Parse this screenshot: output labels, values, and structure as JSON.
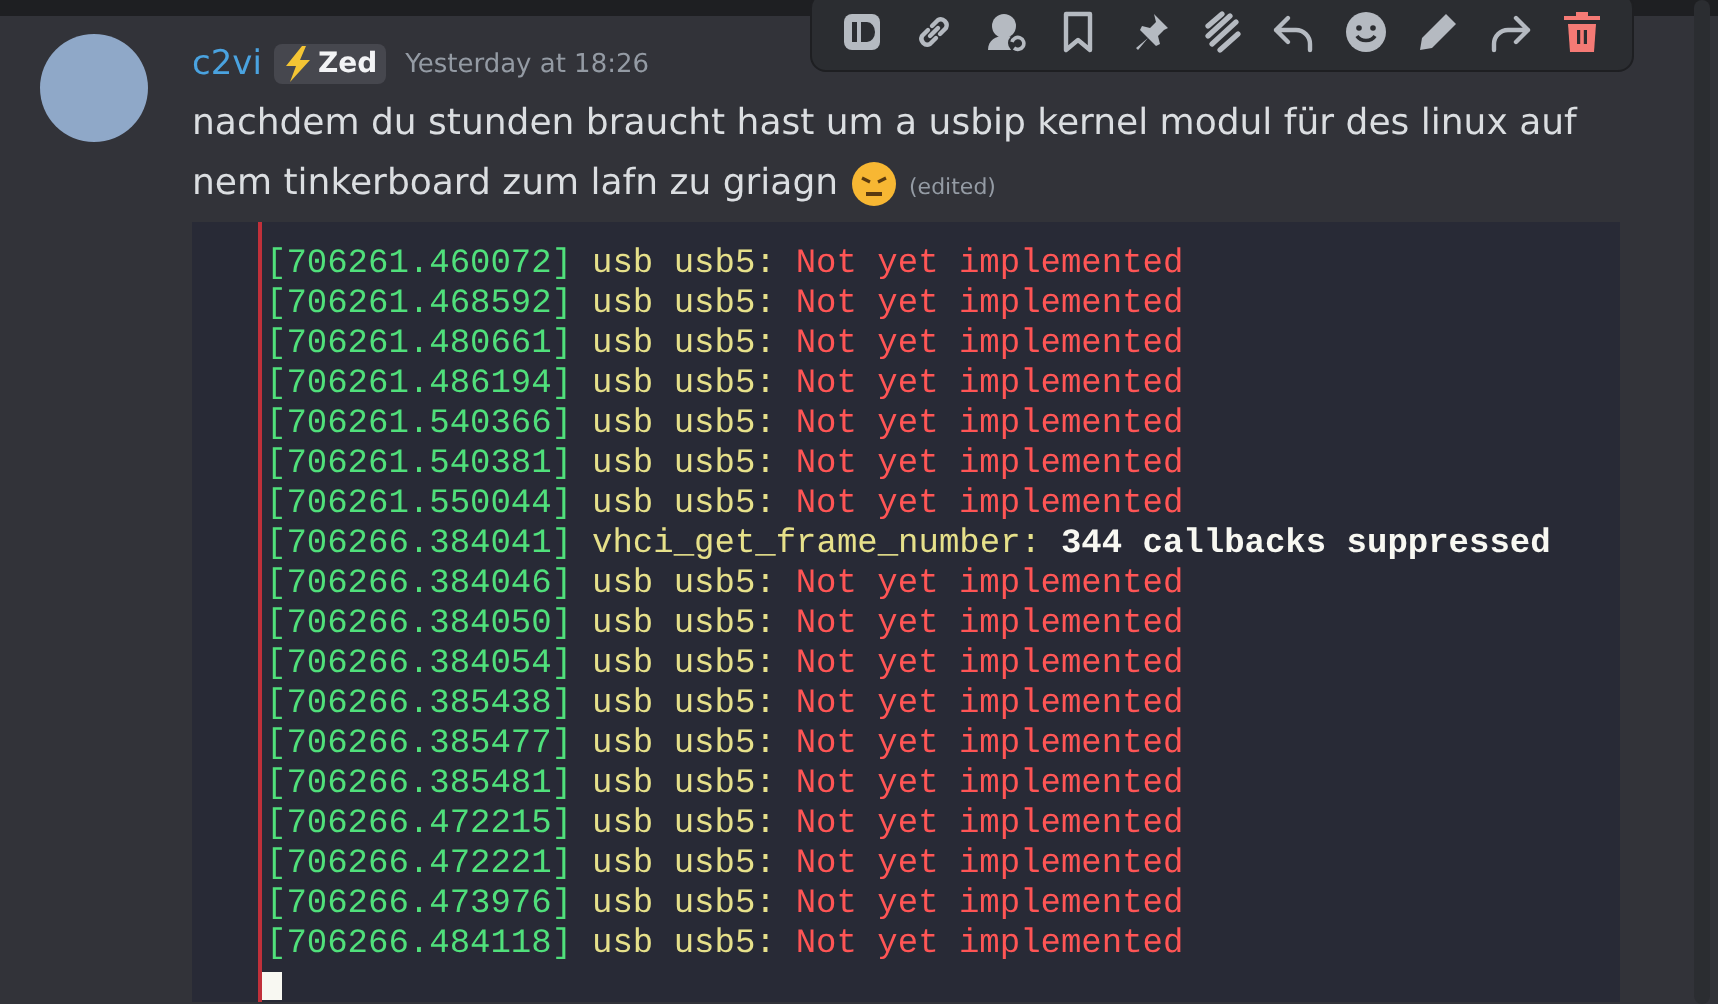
{
  "message": {
    "author": "c2vi",
    "tag": "Zed",
    "timestamp": "Yesterday at 18:26",
    "text": "nachdem du stunden braucht hast um a usbip kernel modul für des linux auf nem tinkerboard zum lafn zu griagn",
    "edited": "(edited)"
  },
  "terminal": {
    "lines": [
      {
        "kind": "error",
        "time": "[706261.460072]",
        "source": "usb usb5:",
        "message": "Not yet implemented"
      },
      {
        "kind": "error",
        "time": "[706261.468592]",
        "source": "usb usb5:",
        "message": "Not yet implemented"
      },
      {
        "kind": "error",
        "time": "[706261.480661]",
        "source": "usb usb5:",
        "message": "Not yet implemented"
      },
      {
        "kind": "error",
        "time": "[706261.486194]",
        "source": "usb usb5:",
        "message": "Not yet implemented"
      },
      {
        "kind": "error",
        "time": "[706261.540366]",
        "source": "usb usb5:",
        "message": "Not yet implemented"
      },
      {
        "kind": "error",
        "time": "[706261.540381]",
        "source": "usb usb5:",
        "message": "Not yet implemented"
      },
      {
        "kind": "error",
        "time": "[706261.550044]",
        "source": "usb usb5:",
        "message": "Not yet implemented"
      },
      {
        "kind": "notice",
        "time": "[706266.384041]",
        "source": "vhci_get_frame_number:",
        "message": "344 callbacks suppressed"
      },
      {
        "kind": "error",
        "time": "[706266.384046]",
        "source": "usb usb5:",
        "message": "Not yet implemented"
      },
      {
        "kind": "error",
        "time": "[706266.384050]",
        "source": "usb usb5:",
        "message": "Not yet implemented"
      },
      {
        "kind": "error",
        "time": "[706266.384054]",
        "source": "usb usb5:",
        "message": "Not yet implemented"
      },
      {
        "kind": "error",
        "time": "[706266.385438]",
        "source": "usb usb5:",
        "message": "Not yet implemented"
      },
      {
        "kind": "error",
        "time": "[706266.385477]",
        "source": "usb usb5:",
        "message": "Not yet implemented"
      },
      {
        "kind": "error",
        "time": "[706266.385481]",
        "source": "usb usb5:",
        "message": "Not yet implemented"
      },
      {
        "kind": "error",
        "time": "[706266.472215]",
        "source": "usb usb5:",
        "message": "Not yet implemented"
      },
      {
        "kind": "error",
        "time": "[706266.472221]",
        "source": "usb usb5:",
        "message": "Not yet implemented"
      },
      {
        "kind": "error",
        "time": "[706266.473976]",
        "source": "usb usb5:",
        "message": "Not yet implemented"
      },
      {
        "kind": "error",
        "time": "[706266.484118]",
        "source": "usb usb5:",
        "message": "Not yet implemented"
      }
    ]
  }
}
